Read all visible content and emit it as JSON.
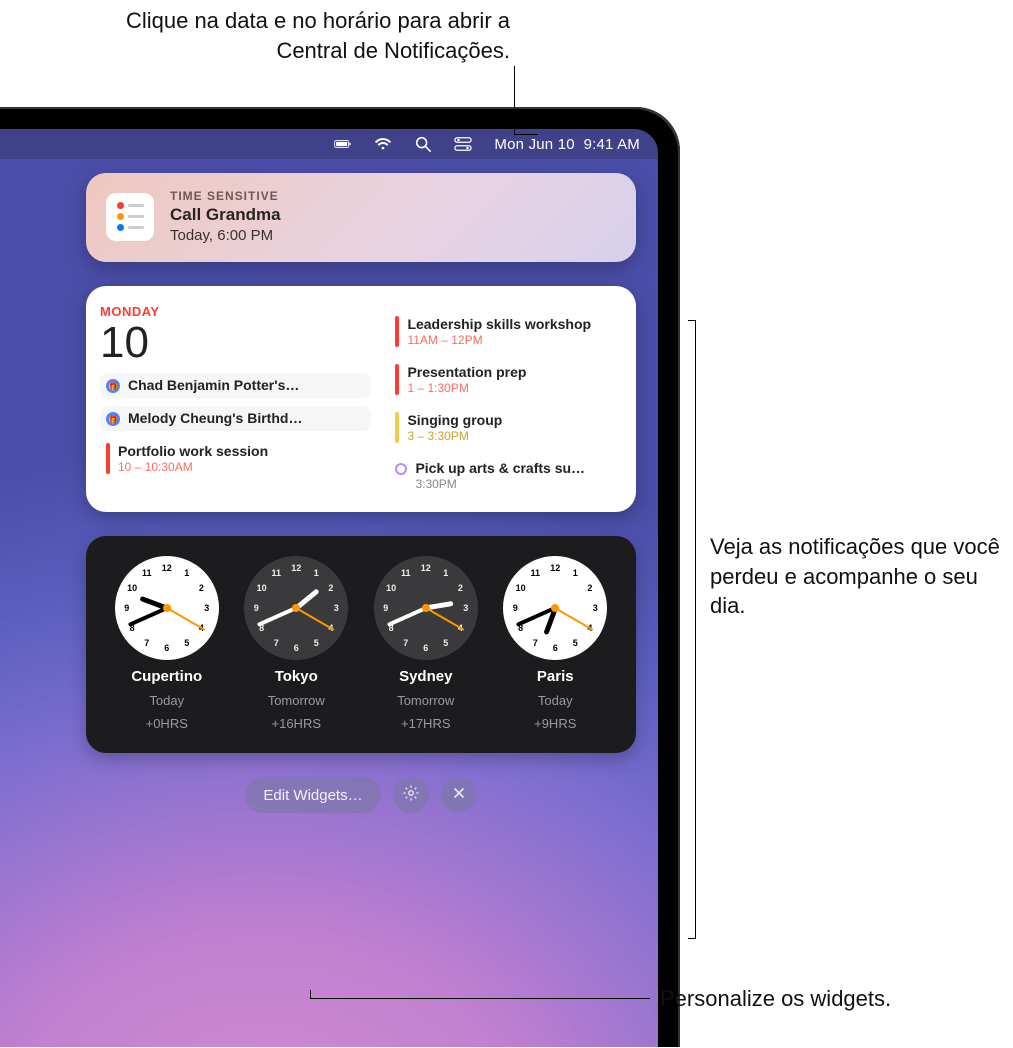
{
  "callouts": {
    "top": "Clique na data e no horário para abrir a Central de Notificações.",
    "right": "Veja as notificações que você perdeu e acompanhe o seu dia.",
    "bottom": "Personalize os widgets."
  },
  "menubar": {
    "date": "Mon Jun 10",
    "time": "9:41 AM"
  },
  "notification": {
    "label": "TIME SENSITIVE",
    "title": "Call Grandma",
    "subtitle": "Today, 6:00 PM"
  },
  "calendar": {
    "dayname": "MONDAY",
    "daynum": "10",
    "left_events": [
      {
        "type": "birthday",
        "title": "Chad Benjamin Potter's…"
      },
      {
        "type": "birthday",
        "title": "Melody Cheung's Birthd…"
      },
      {
        "type": "bar",
        "color": "#ff3b30",
        "title": "Portfolio work session",
        "time": "10 – 10:30AM"
      }
    ],
    "right_events": [
      {
        "type": "bar",
        "color": "#ff3b30",
        "title": "Leadership skills workshop",
        "time": "11AM – 12PM"
      },
      {
        "type": "bar",
        "color": "#ff3b30",
        "title": "Presentation prep",
        "time": "1 – 1:30PM"
      },
      {
        "type": "bar",
        "color": "#f7c948",
        "title": "Singing group",
        "time": "3 – 3:30PM"
      },
      {
        "type": "ring",
        "title": "Pick up arts & crafts su…",
        "time": "3:30PM"
      }
    ]
  },
  "clocks": [
    {
      "city": "Cupertino",
      "day": "Today",
      "offset": "+0HRS",
      "dark": false,
      "h": 9,
      "m": 41
    },
    {
      "city": "Tokyo",
      "day": "Tomorrow",
      "offset": "+16HRS",
      "dark": true,
      "h": 1,
      "m": 41
    },
    {
      "city": "Sydney",
      "day": "Tomorrow",
      "offset": "+17HRS",
      "dark": true,
      "h": 2,
      "m": 41
    },
    {
      "city": "Paris",
      "day": "Today",
      "offset": "+9HRS",
      "dark": false,
      "h": 18,
      "m": 41
    }
  ],
  "controls": {
    "edit": "Edit Widgets…"
  }
}
